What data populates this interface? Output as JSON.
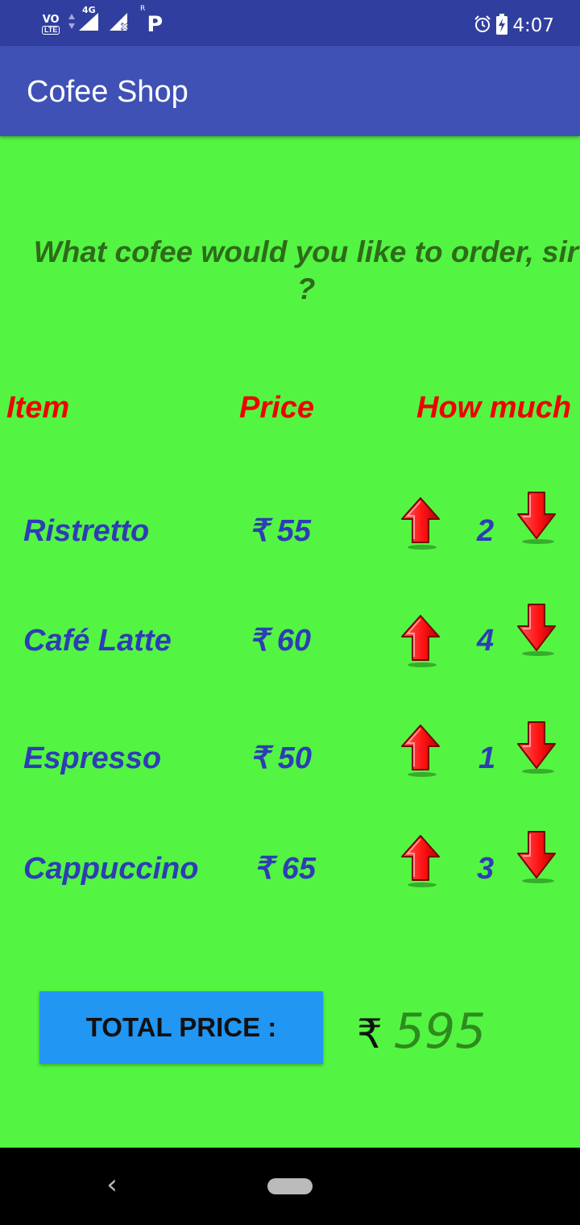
{
  "status_bar": {
    "volte_top": "VO",
    "volte_bottom": "LTE",
    "network": "4G",
    "roaming": "R",
    "app_icon": "P",
    "time": "4:07",
    "icons": [
      "volte-icon",
      "signal-icon",
      "signal-x-icon",
      "p-notification-icon",
      "alarm-icon",
      "battery-charging-icon"
    ]
  },
  "app_bar": {
    "title": "Cofee Shop"
  },
  "main": {
    "question": "What cofee would you like to order, sir ?",
    "headers": {
      "item": "Item",
      "price": "Price",
      "quantity": "How much ?"
    },
    "items": [
      {
        "name": "Ristretto",
        "price": "₹ 55",
        "quantity": "2"
      },
      {
        "name": "Café Latte",
        "price": "₹ 60",
        "quantity": "4"
      },
      {
        "name": "Espresso",
        "price": "₹ 50",
        "quantity": "1"
      },
      {
        "name": "Cappuccino",
        "price": "₹ 65",
        "quantity": "3"
      }
    ],
    "total_label": "TOTAL PRICE :",
    "total_currency": "₹",
    "total_amount": "595"
  },
  "nav_bar": {
    "back_symbol": "‹",
    "icons": [
      "back-icon",
      "home-pill-icon"
    ]
  },
  "colors": {
    "background": "#53f542",
    "status_bar": "#303f9f",
    "app_bar": "#3f51b5",
    "header_text": "#f00000",
    "item_text": "#2e3db5",
    "question_text": "#2e6b1a",
    "button": "#2196f3",
    "total_amount": "#2e8b1e",
    "arrow": "#ff1a1a"
  }
}
